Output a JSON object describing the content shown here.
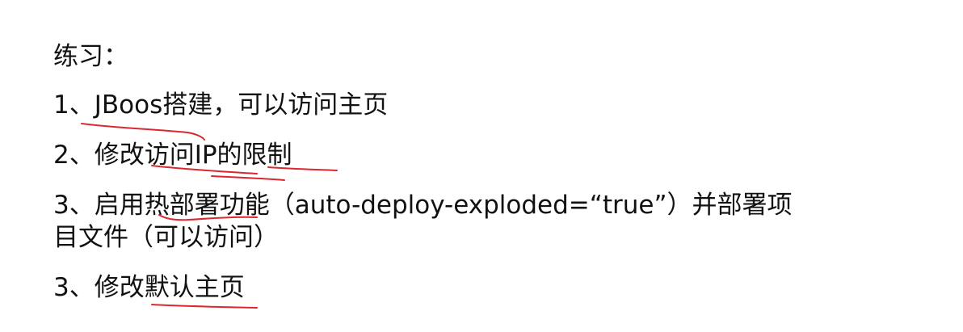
{
  "heading": "练习：",
  "items": [
    "1、JBoos搭建，可以访问主页",
    "2、修改访问IP的限制",
    "3、启用热部署功能（auto-deploy-exploded=“true”）并部署项",
    "目文件（可以访问）",
    "3、修改默认主页"
  ],
  "annotation_color": "#d9282f"
}
